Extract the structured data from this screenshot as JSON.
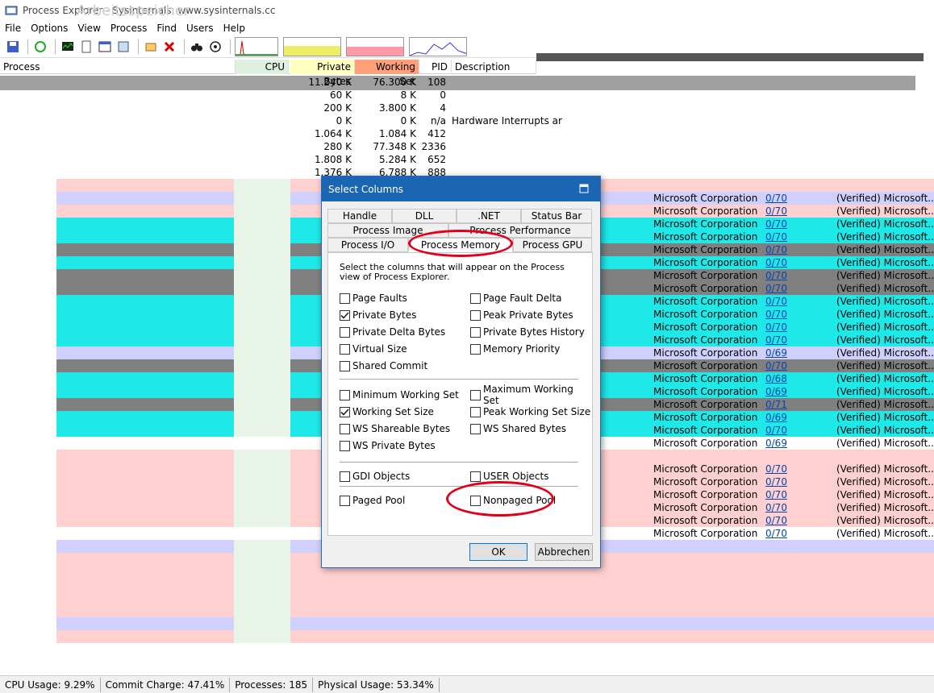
{
  "window": {
    "title": "Process Explorer - Sysinternals: www.sysinternals.cc",
    "title_overlay": "Arbeitsspeicher",
    "icon": "process-explorer-icon"
  },
  "menu": [
    "File",
    "Options",
    "View",
    "Process",
    "Find",
    "Users",
    "Help"
  ],
  "toolbar": {
    "icons": [
      "save-icon",
      "refresh-icon",
      "system-info-icon",
      "properties-icon",
      "window-icon",
      "settings-icon",
      "find-handle-icon",
      "kill-process-icon",
      "binoculars-icon",
      "target-icon"
    ]
  },
  "columns": {
    "process": "Process",
    "cpu": "CPU",
    "private_bytes": "Private Bytes",
    "working_set": "Working Set",
    "pid": "PID",
    "description": "Description"
  },
  "rows": [
    {
      "private": "11.240 K",
      "ws": "76.300 K",
      "pid": "108",
      "desc": ""
    },
    {
      "private": "60 K",
      "ws": "8 K",
      "pid": "0",
      "desc": ""
    },
    {
      "private": "200 K",
      "ws": "3.800 K",
      "pid": "4",
      "desc": ""
    },
    {
      "private": "0 K",
      "ws": "0 K",
      "pid": "n/a",
      "desc": "Hardware Interrupts ar"
    },
    {
      "private": "1.064 K",
      "ws": "1.084 K",
      "pid": "412",
      "desc": ""
    },
    {
      "private": "280 K",
      "ws": "77.348 K",
      "pid": "2336",
      "desc": ""
    },
    {
      "private": "1.808 K",
      "ws": "5.284 K",
      "pid": "652",
      "desc": ""
    },
    {
      "private": "1.376 K",
      "ws": "6.788 K",
      "pid": "888",
      "desc": ""
    }
  ],
  "right_rows": [
    {
      "company": "Microsoft Corporation",
      "ver": "0/70",
      "verified": "(Verified) Microsoft..."
    },
    {
      "company": "Microsoft Corporation",
      "ver": "0/70",
      "verified": "(Verified) Microsoft..."
    },
    {
      "company": "Microsoft Corporation",
      "ver": "0/70",
      "verified": "(Verified) Microsoft..."
    },
    {
      "company": "Microsoft Corporation",
      "ver": "0/70",
      "verified": "(Verified) Microsoft..."
    },
    {
      "company": "Microsoft Corporation",
      "ver": "0/70",
      "verified": "(Verified) Microsoft..."
    },
    {
      "company": "Microsoft Corporation",
      "ver": "0/70",
      "verified": "(Verified) Microsoft..."
    },
    {
      "company": "Microsoft Corporation",
      "ver": "0/70",
      "verified": "(Verified) Microsoft..."
    },
    {
      "company": "Microsoft Corporation",
      "ver": "0/70",
      "verified": "(Verified) Microsoft..."
    },
    {
      "company": "Microsoft Corporation",
      "ver": "0/70",
      "verified": "(Verified) Microsoft..."
    },
    {
      "company": "Microsoft Corporation",
      "ver": "0/70",
      "verified": "(Verified) Microsoft..."
    },
    {
      "company": "Microsoft Corporation",
      "ver": "0/70",
      "verified": "(Verified) Microsoft..."
    },
    {
      "company": "Microsoft Corporation",
      "ver": "0/70",
      "verified": "(Verified) Microsoft..."
    },
    {
      "company": "Microsoft Corporation",
      "ver": "0/69",
      "verified": "(Verified) Microsoft..."
    },
    {
      "company": "Microsoft Corporation",
      "ver": "0/70",
      "verified": "(Verified) Microsoft..."
    },
    {
      "company": "Microsoft Corporation",
      "ver": "0/68",
      "verified": "(Verified) Microsoft..."
    },
    {
      "company": "Microsoft Corporation",
      "ver": "0/69",
      "verified": "(Verified) Microsoft..."
    },
    {
      "company": "Microsoft Corporation",
      "ver": "0/71",
      "verified": "(Verified) Microsoft..."
    },
    {
      "company": "Microsoft Corporation",
      "ver": "0/69",
      "verified": "(Verified) Microsoft..."
    },
    {
      "company": "Microsoft Corporation",
      "ver": "0/70",
      "verified": "(Verified) Microsoft..."
    },
    {
      "company": "Microsoft Corporation",
      "ver": "0/69",
      "verified": "(Verified) Microsoft..."
    },
    {
      "company": "",
      "ver": "",
      "verified": ""
    },
    {
      "company": "Microsoft Corporation",
      "ver": "0/70",
      "verified": "(Verified) Microsoft..."
    },
    {
      "company": "Microsoft Corporation",
      "ver": "0/70",
      "verified": "(Verified) Microsoft..."
    },
    {
      "company": "Microsoft Corporation",
      "ver": "0/70",
      "verified": "(Verified) Microsoft..."
    },
    {
      "company": "Microsoft Corporation",
      "ver": "0/70",
      "verified": "(Verified) Microsoft..."
    },
    {
      "company": "Microsoft Corporation",
      "ver": "0/70",
      "verified": "(Verified) Microsoft..."
    },
    {
      "company": "Microsoft Corporation",
      "ver": "0/70",
      "verified": "(Verified) Microsoft..."
    }
  ],
  "status": {
    "cpu": "CPU Usage: 9.29%",
    "commit": "Commit Charge: 47.41%",
    "processes": "Processes: 185",
    "physical": "Physical Usage: 53.34%"
  },
  "dialog": {
    "title": "Select Columns",
    "tabs_row1": [
      "Handle",
      "DLL",
      ".NET",
      "Status Bar"
    ],
    "tabs_row2": [
      "Process Image",
      "Process Performance"
    ],
    "tabs_row3": [
      "Process I/O",
      "Process Memory",
      "Process GPU"
    ],
    "active_tab": "Process Memory",
    "intro": "Select the columns that will appear on the Process view of Process Explorer.",
    "group1": [
      {
        "label": "Page Faults",
        "checked": false
      },
      {
        "label": "Page Fault Delta",
        "checked": false
      },
      {
        "label": "Private Bytes",
        "checked": true
      },
      {
        "label": "Peak Private Bytes",
        "checked": false
      },
      {
        "label": "Private Delta Bytes",
        "checked": false
      },
      {
        "label": "Private Bytes History",
        "checked": false
      },
      {
        "label": "Virtual Size",
        "checked": false
      },
      {
        "label": "Memory Priority",
        "checked": false
      },
      {
        "label": "Shared Commit",
        "checked": false
      }
    ],
    "group2": [
      {
        "label": "Minimum Working Set",
        "checked": false
      },
      {
        "label": "Maximum Working Set",
        "checked": false
      },
      {
        "label": "Working Set Size",
        "checked": true
      },
      {
        "label": "Peak Working Set Size",
        "checked": false
      },
      {
        "label": "WS Shareable Bytes",
        "checked": false
      },
      {
        "label": "WS Shared Bytes",
        "checked": false
      },
      {
        "label": "WS Private Bytes",
        "checked": false
      }
    ],
    "group3": [
      {
        "label": "GDI Objects",
        "checked": false
      },
      {
        "label": "USER Objects",
        "checked": false
      }
    ],
    "group4": [
      {
        "label": "Paged Pool",
        "checked": false
      },
      {
        "label": "Nonpaged Pool",
        "checked": false
      }
    ],
    "ok": "OK",
    "cancel": "Abbrechen"
  },
  "colors": {
    "pink": "#ffd0d0",
    "lavender": "#d0d0ff",
    "cyan": "#1ee8e8",
    "gray": "#808080",
    "dialog_title": "#1a66b3",
    "highlight": "#e0001a",
    "private_header": "#ffffc0",
    "ws_header": "#ffa07a"
  }
}
